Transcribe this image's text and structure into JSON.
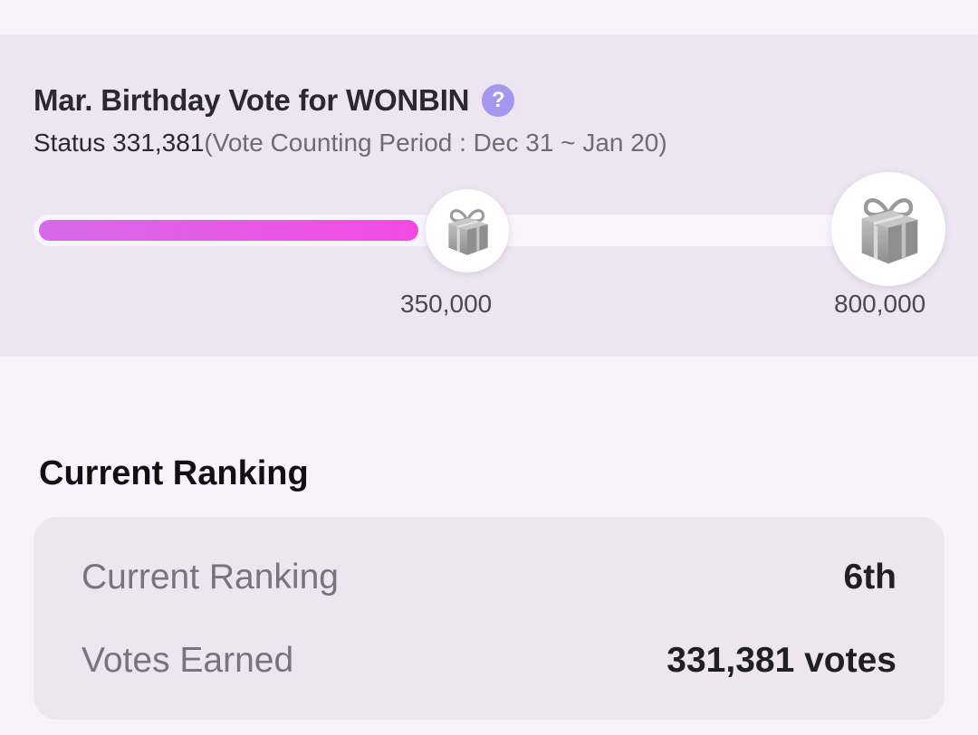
{
  "vote": {
    "title": "Mar. Birthday Vote for WONBIN",
    "help_icon": "question-icon",
    "status_label": "Status",
    "status_value": "331,381",
    "period": "(Vote Counting Period : Dec 31 ~ Jan 20)",
    "progress_fraction": 0.449,
    "milestones": [
      {
        "value": "350,000",
        "icon": "gift-icon"
      },
      {
        "value": "800,000",
        "icon": "gift-icon"
      }
    ],
    "colors": {
      "accent": "#a596ef",
      "progress_start": "#d66ae8",
      "progress_end": "#f24ae3",
      "panel_background": "#ede6f2"
    }
  },
  "ranking": {
    "section_title": "Current Ranking",
    "rows": [
      {
        "label": "Current Ranking",
        "value": "6th"
      },
      {
        "label": "Votes Earned",
        "value": "331,381 votes"
      }
    ]
  }
}
